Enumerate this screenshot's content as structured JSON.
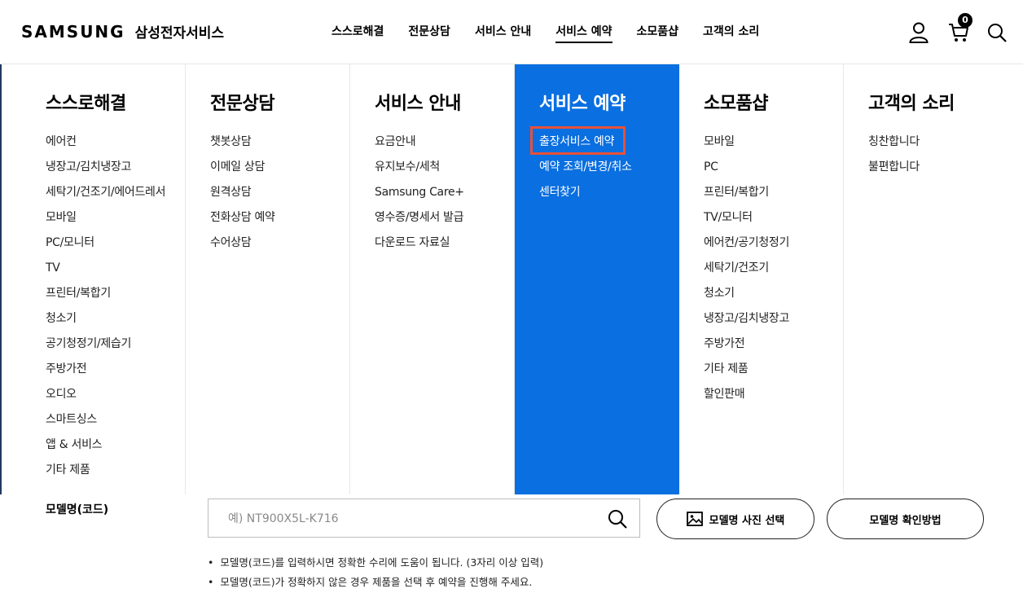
{
  "header": {
    "logo_word": "SAMSUNG",
    "logo_sub": "삼성전자서비스",
    "nav": [
      {
        "label": "스스로해결"
      },
      {
        "label": "전문상담"
      },
      {
        "label": "서비스 안내"
      },
      {
        "label": "서비스 예약"
      },
      {
        "label": "소모품샵"
      },
      {
        "label": "고객의 소리"
      }
    ],
    "active_nav": "서비스 예약",
    "cart_count": "0"
  },
  "mega_menu": {
    "columns": [
      {
        "title": "스스로해결",
        "items": [
          "에어컨",
          "냉장고/김치냉장고",
          "세탁기/건조기/에어드레서",
          "모바일",
          "PC/모니터",
          "TV",
          "프린터/복합기",
          "청소기",
          "공기청정기/제습기",
          "주방가전",
          "오디오",
          "스마트싱스",
          "앱 & 서비스",
          "기타 제품"
        ]
      },
      {
        "title": "전문상담",
        "items": [
          "챗봇상담",
          "이메일 상담",
          "원격상담",
          "전화상담 예약",
          "수어상담"
        ]
      },
      {
        "title": "서비스 안내",
        "items": [
          "요금안내",
          "유지보수/세척",
          "Samsung Care+",
          "영수증/명세서 발급",
          "다운로드 자료실"
        ]
      },
      {
        "title": "서비스 예약",
        "items": [
          "출장서비스 예약",
          "예약 조회/변경/취소",
          "센터찾기"
        ]
      },
      {
        "title": "소모품샵",
        "items": [
          "모바일",
          "PC",
          "프린터/복합기",
          "TV/모니터",
          "에어컨/공기청정기",
          "세탁기/건조기",
          "청소기",
          "냉장고/김치냉장고",
          "주방가전",
          "기타 제품",
          "할인판매"
        ]
      },
      {
        "title": "고객의 소리",
        "items": [
          "칭찬합니다",
          "불편합니다"
        ]
      }
    ],
    "active_color": "#0a6fe0",
    "highlight_color": "#e8503a"
  },
  "model_search": {
    "label": "모델명(코드)",
    "placeholder": "예) NT900X5L-K716",
    "photo_button": "모델명 사진 선택",
    "help_button": "모델명 확인방법",
    "notes": [
      "모델명(코드)를 입력하시면 정확한 수리에 도움이 됩니다. (3자리 이상 입력)",
      "모델명(코드)가 정확하지 않은 경우 제품을 선택 후 예약을 진행해 주세요."
    ]
  }
}
